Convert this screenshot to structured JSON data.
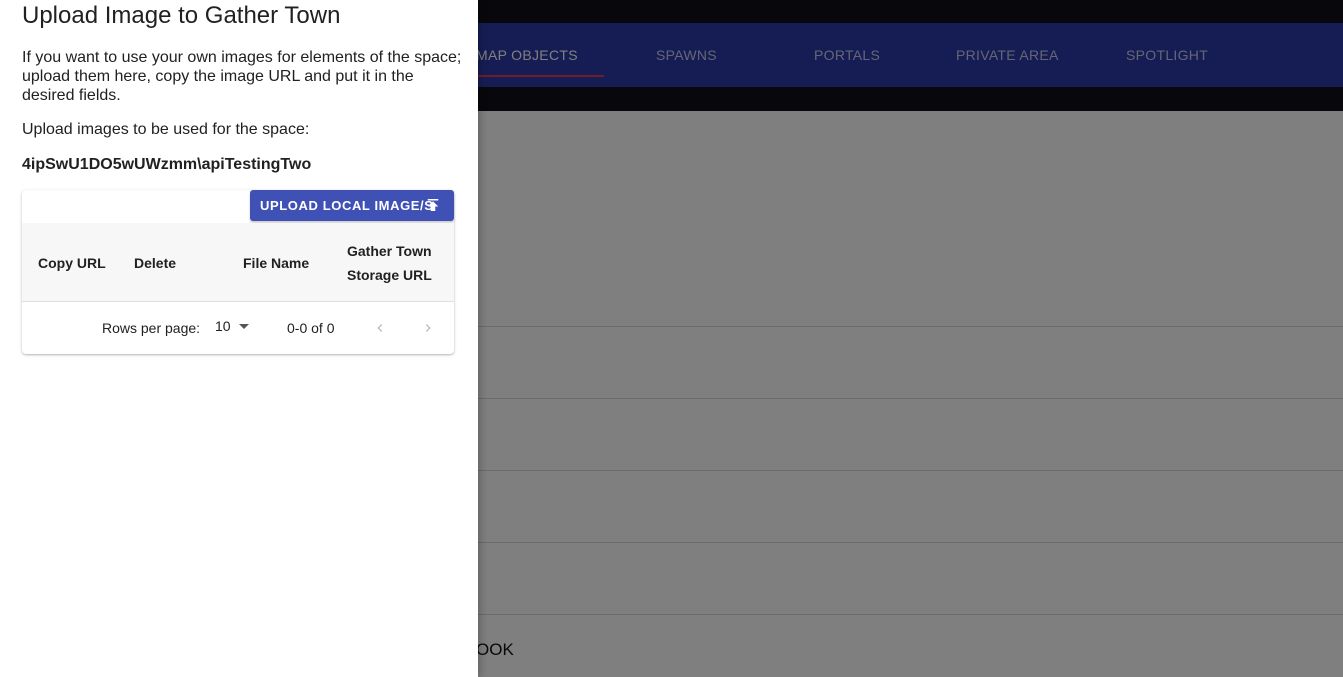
{
  "app": {
    "tabs": [
      {
        "label": "MAP OBJECTS",
        "active": true
      },
      {
        "label": "SPAWNS",
        "active": false
      },
      {
        "label": "PORTALS",
        "active": false
      },
      {
        "label": "PRIVATE AREA",
        "active": false
      },
      {
        "label": "SPOTLIGHT",
        "active": false
      }
    ],
    "bottom_row_text": "OOK",
    "colors": {
      "tab_bar": "#2d3ba8",
      "tab_indicator": "#e53950",
      "top_bar": "#111118"
    }
  },
  "drawer": {
    "title": "Upload Image to Gather Town",
    "description": "If you want to use your own images for elements of the space; upload them here, copy the image URL and put it in the desired fields.",
    "upload_label": "Upload images to be used for the space:",
    "space_path": "4ipSwU1DO5wUWzmm\\apiTestingTwo",
    "upload_button_label": "UPLOAD LOCAL IMAGE/S",
    "upload_button_icon": "upload-icon",
    "table": {
      "columns": [
        "Copy URL",
        "Delete",
        "File Name",
        "Gather Town Storage URL"
      ],
      "rows": [],
      "rows_per_page_label": "Rows per page:",
      "rows_per_page_value": "10",
      "range_text": "0-0 of 0"
    },
    "colors": {
      "button": "#3f51b5"
    }
  }
}
